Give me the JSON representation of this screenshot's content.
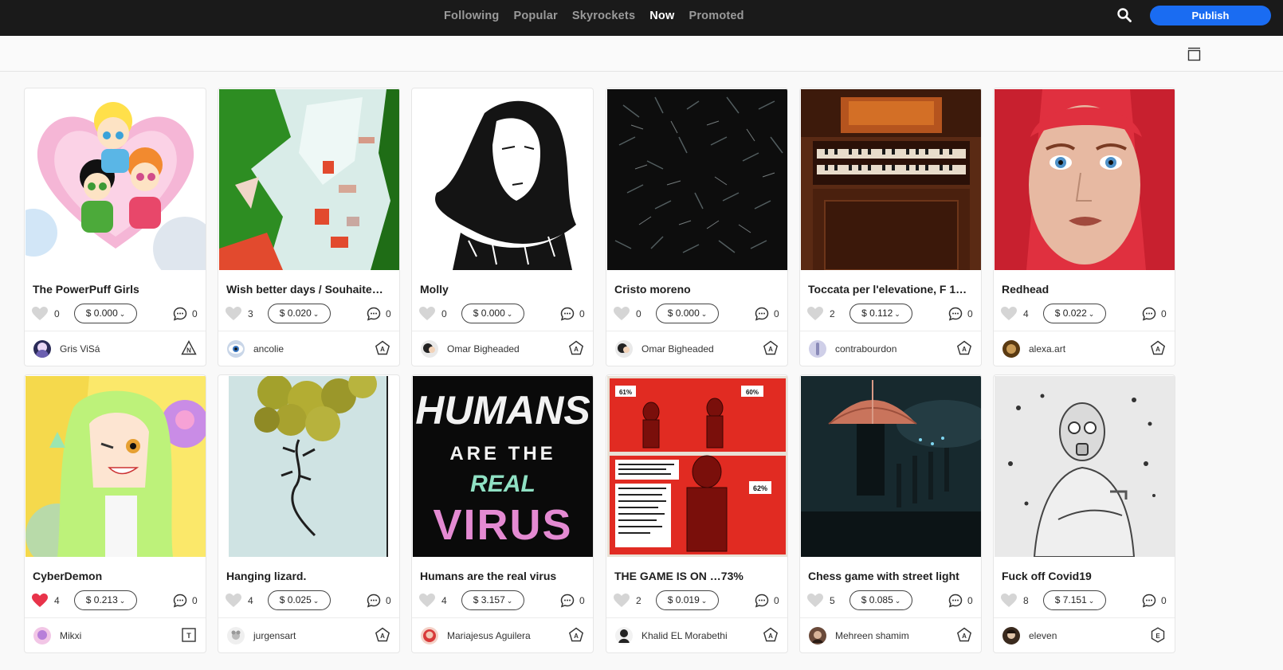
{
  "nav": {
    "tabs": [
      "Following",
      "Popular",
      "Skyrockets",
      "Now",
      "Promoted"
    ],
    "active": "Now"
  },
  "header": {
    "publish_label": "Publish",
    "search_icon": "search-icon"
  },
  "toolbar": {
    "layout_icon": "layout-toggle-icon"
  },
  "colors": {
    "topbar": "#1a1a1a",
    "accent": "#1a6cf2",
    "liked": "#e8334a"
  },
  "cards": [
    {
      "title": "The PowerPuff Girls",
      "likes": "0",
      "liked": false,
      "price": "$ 0.000",
      "comments": "0",
      "author": "Gris ViSá",
      "badge": "N"
    },
    {
      "title": "Wish better days / Souhaite…",
      "likes": "3",
      "liked": false,
      "price": "$ 0.020",
      "comments": "0",
      "author": "ancolie",
      "badge": "A"
    },
    {
      "title": "Molly",
      "likes": "0",
      "liked": false,
      "price": "$ 0.000",
      "comments": "0",
      "author": "Omar Bigheaded",
      "badge": "A"
    },
    {
      "title": "Cristo moreno",
      "likes": "0",
      "liked": false,
      "price": "$ 0.000",
      "comments": "0",
      "author": "Omar Bigheaded",
      "badge": "A"
    },
    {
      "title": "Toccata per l'elevatione, F 1…",
      "likes": "2",
      "liked": false,
      "price": "$ 0.112",
      "comments": "0",
      "author": "contrabourdon",
      "badge": "A"
    },
    {
      "title": "Redhead",
      "likes": "4",
      "liked": false,
      "price": "$ 0.022",
      "comments": "0",
      "author": "alexa.art",
      "badge": "A"
    },
    {
      "title": "CyberDemon",
      "likes": "4",
      "liked": true,
      "price": "$ 0.213",
      "comments": "0",
      "author": "Mikxi",
      "badge": "T"
    },
    {
      "title": "Hanging lizard.",
      "likes": "4",
      "liked": false,
      "price": "$ 0.025",
      "comments": "0",
      "author": "jurgensart",
      "badge": "A"
    },
    {
      "title": "Humans are the real virus",
      "likes": "4",
      "liked": false,
      "price": "$ 3.157",
      "comments": "0",
      "author": "Mariajesus Aguilera",
      "badge": "A"
    },
    {
      "title": "THE GAME IS ON …73%",
      "likes": "2",
      "liked": false,
      "price": "$ 0.019",
      "comments": "0",
      "author": "Khalid EL Morabethi",
      "badge": "A"
    },
    {
      "title": "Chess game with street light",
      "likes": "5",
      "liked": false,
      "price": "$ 0.085",
      "comments": "0",
      "author": "Mehreen shamim",
      "badge": "A"
    },
    {
      "title": "Fuck off Covid19",
      "likes": "8",
      "liked": false,
      "price": "$ 7.151",
      "comments": "0",
      "author": "eleven",
      "badge": "E"
    }
  ],
  "artwork_text": {
    "humans": [
      "HUMANS",
      "ARE THE",
      "REAL",
      "VIRUS"
    ],
    "game": [
      "61%",
      "60%",
      "62%"
    ]
  }
}
